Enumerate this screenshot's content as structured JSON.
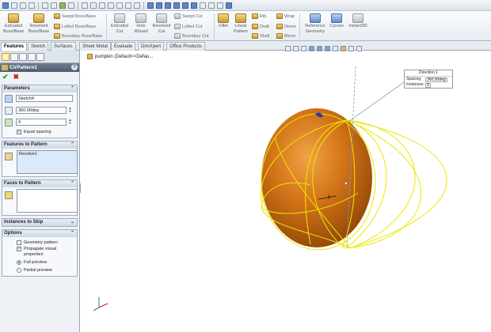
{
  "ribbon": {
    "extruded_boss": "Extruded\nBoss/Base",
    "revolved_boss": "Revolved\nBoss/Base",
    "swept_boss": "Swept Boss/Base",
    "lofted_boss": "Lofted Boss/Base",
    "boundary_boss": "Boundary Boss/Base",
    "extruded_cut": "Extruded\nCut",
    "hole_wizard": "Hole\nWizard",
    "revolved_cut": "Revolved\nCut",
    "swept_cut": "Swept Cut",
    "lofted_cut": "Lofted Cut",
    "boundary_cut": "Boundary Cut",
    "fillet": "Fillet",
    "linear_pattern": "Linear\nPattern",
    "rib": "Rib",
    "draft": "Draft",
    "shell": "Shell",
    "wrap": "Wrap",
    "dome": "Dome",
    "mirror": "Mirror",
    "reference_geometry": "Reference\nGeometry",
    "curves": "Curves",
    "instant3d": "Instant3D"
  },
  "tabs": [
    "Features",
    "Sketch",
    "Surfaces",
    "Sheet Metal",
    "Evaluate",
    "DimXpert",
    "Office Products"
  ],
  "panel": {
    "title": "CirPattern1",
    "help": "?",
    "ok": "✔",
    "cancel": "✖",
    "parameters": {
      "header": "Parameters",
      "axis": "Sketch4",
      "angle": "360.00deg",
      "instances": "9",
      "equal_spacing": "Equal spacing"
    },
    "features_to_pattern": {
      "header": "Features to Pattern",
      "item": "Revolve1"
    },
    "faces_to_pattern": {
      "header": "Faces to Pattern"
    },
    "instances_to_skip": {
      "header": "Instances to Skip"
    },
    "options": {
      "header": "Options",
      "geometry_pattern": "Geometry pattern",
      "propagate": "Propagate visual\nproperties",
      "full_preview": "Full preview",
      "partial_preview": "Partial preview"
    }
  },
  "graphics": {
    "tree_label": "pumpkin  (Default<<Defau...",
    "callout": {
      "title": "Direction 1",
      "spacing_label": "Spacing:",
      "spacing_value": "360.00deg",
      "instances_label": "Instances:",
      "instances_value": "9"
    }
  },
  "colors": {
    "pumpkin": "#c9650e",
    "preview": "#f0e600",
    "panel_title": "#56657a"
  }
}
